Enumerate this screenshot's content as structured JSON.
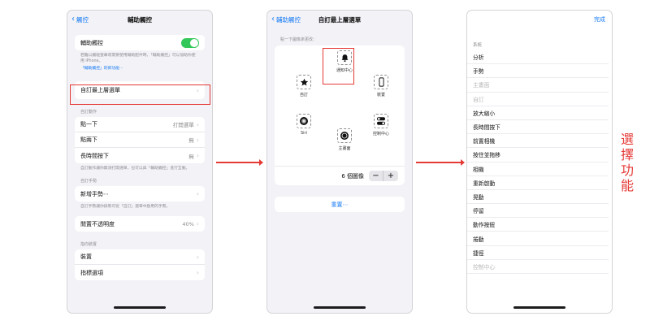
{
  "phone1": {
    "nav": {
      "back": "觸控",
      "title": "輔助觸控"
    },
    "assistive_toggle_label": "輔助觸控",
    "assistive_desc": "若難以觸碰螢幕或需要使用輔助配件時，「輔助觸控」可以協助你使用 iPhone。",
    "assistive_link": "「輔助觸控」的新功能⋯",
    "custom_menu_label": "自訂最上層選單",
    "custom_actions_header": "自訂動作",
    "actions": [
      {
        "label": "點一下",
        "value": "打開選單"
      },
      {
        "label": "點兩下",
        "value": "無"
      },
      {
        "label": "長時間按下",
        "value": "無"
      }
    ],
    "actions_footer": "自訂動作讓你無須打開選單，也可以與「輔助觸控」進行互動。",
    "custom_gestures_header": "自訂手勢",
    "new_gesture_label": "新增手勢⋯",
    "gestures_footer": "自訂手勢讓你錄製可從「自訂」選單中啟用的手勢。",
    "idle_opacity_label": "閒置不透明度",
    "idle_opacity_value": "40%",
    "devices_header": "指向裝置",
    "devices_label": "裝置",
    "cut_label": "指標選項"
  },
  "phone2": {
    "nav": {
      "back": "輔助觸控",
      "title": "自訂最上層選單"
    },
    "hint": "點一下圖像來更改：",
    "slots": [
      {
        "label": "通知中心",
        "icon": "bell-icon"
      },
      {
        "label": "自訂",
        "icon": "star-icon"
      },
      {
        "label": "裝置",
        "icon": "iphone-icon"
      },
      {
        "label": "Siri",
        "icon": "siri-icon"
      },
      {
        "label": "控制中心",
        "icon": "toggles-icon"
      },
      {
        "label": "主畫面",
        "icon": "home-button-icon"
      }
    ],
    "count_label": "6 個圖像",
    "minus": "−",
    "plus": "+",
    "reset": "重置⋯"
  },
  "phone3": {
    "done": "完成",
    "section": "系統",
    "items": [
      {
        "label": "分析",
        "dim": false
      },
      {
        "label": "手勢",
        "dim": false
      },
      {
        "label": "主畫面",
        "dim": true
      },
      {
        "label": "自訂",
        "dim": true
      },
      {
        "label": "放大縮小",
        "dim": false
      },
      {
        "label": "長時間按下",
        "dim": false
      },
      {
        "label": "前置相機",
        "dim": false
      },
      {
        "label": "按住並拖移",
        "dim": false
      },
      {
        "label": "相機",
        "dim": false
      },
      {
        "label": "重新啟動",
        "dim": false
      },
      {
        "label": "晃動",
        "dim": false
      },
      {
        "label": "停留",
        "dim": false
      },
      {
        "label": "動作按鈕",
        "dim": false
      },
      {
        "label": "捲動",
        "dim": false
      },
      {
        "label": "捷徑",
        "dim": false
      },
      {
        "label": "控制中心",
        "dim": true
      }
    ]
  },
  "caption": "選擇功能",
  "colors": {
    "accent": "#1a7cf5",
    "toggle_on": "#34c759",
    "annotation_red": "#e53935"
  }
}
